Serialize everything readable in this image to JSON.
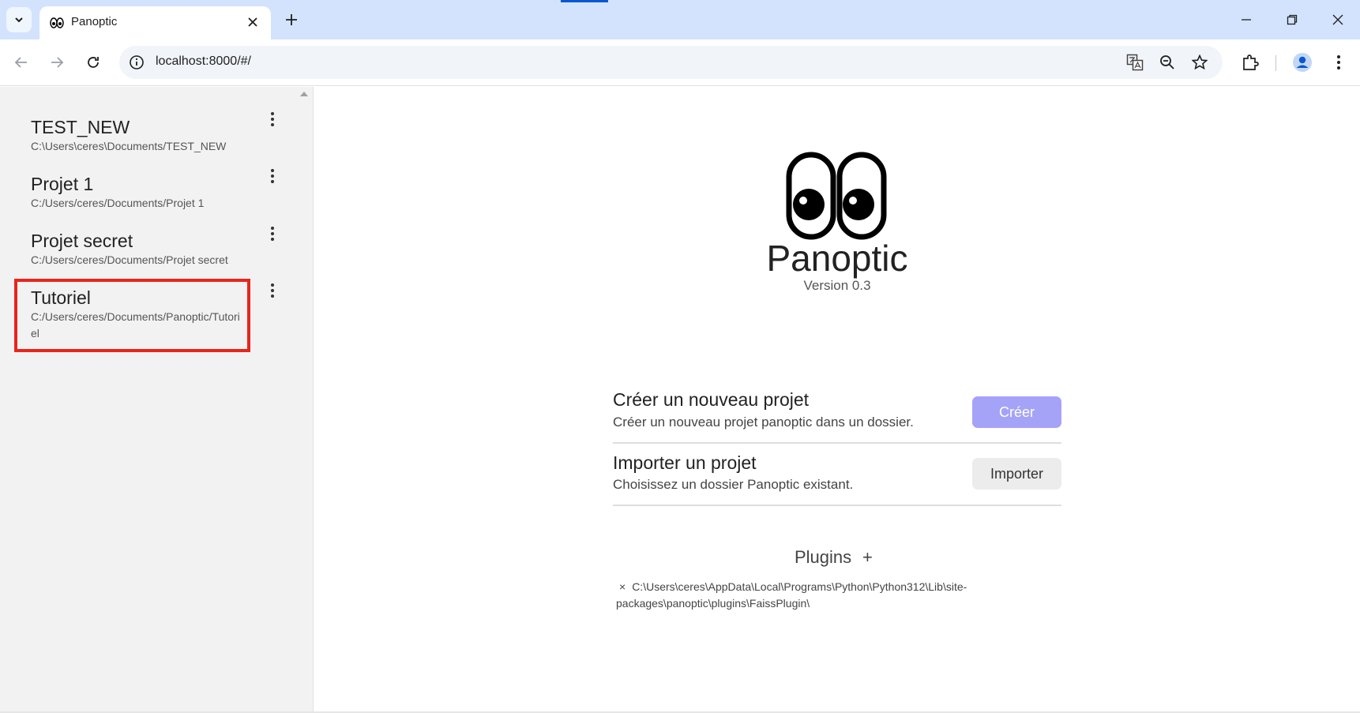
{
  "browser": {
    "tab_title": "Panoptic",
    "url": "localhost:8000/#/"
  },
  "sidebar": {
    "projects": [
      {
        "name": "TEST_NEW",
        "path": "C:\\Users\\ceres\\Documents/TEST_NEW"
      },
      {
        "name": "Projet 1",
        "path": "C:/Users/ceres/Documents/Projet 1"
      },
      {
        "name": "Projet secret",
        "path": "C:/Users/ceres/Documents/Projet secret"
      },
      {
        "name": "Tutoriel",
        "path": "C:/Users/ceres/Documents/Panoptic/Tutoriel"
      }
    ]
  },
  "main": {
    "app_name": "Panoptic",
    "version": "Version 0.3",
    "create": {
      "title": "Créer un nouveau projet",
      "description": "Créer un nouveau projet panoptic dans un dossier.",
      "button": "Créer"
    },
    "import": {
      "title": "Importer un projet",
      "description": "Choisissez un dossier Panoptic existant.",
      "button": "Importer"
    },
    "plugins": {
      "title": "Plugins",
      "add_symbol": "+",
      "remove_symbol": "×",
      "items": [
        "C:\\Users\\ceres\\AppData\\Local\\Programs\\Python\\Python312\\Lib\\site-packages\\panoptic\\plugins\\FaissPlugin\\"
      ]
    }
  },
  "colors": {
    "create_button": "#a5a3f7",
    "highlight_box": "#e8251c",
    "tabbar": "#d3e3fd"
  }
}
